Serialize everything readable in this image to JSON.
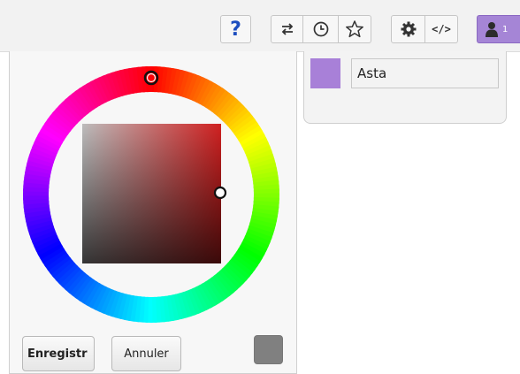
{
  "toolbar": {
    "help_label": "?",
    "user_count": "1",
    "user_color": "#a585d6",
    "icons": [
      "help-icon",
      "swap-icon",
      "history-icon",
      "star-icon",
      "gear-icon",
      "code-icon",
      "user-icon"
    ]
  },
  "color_picker": {
    "hue_ring": "full-spectrum",
    "square_base_color": "#d02020",
    "current_color": "#808080",
    "save_label": "Enregistr",
    "cancel_label": "Annuler"
  },
  "user": {
    "color": "#a880d8",
    "name_value": "Asta",
    "name_placeholder": ""
  }
}
